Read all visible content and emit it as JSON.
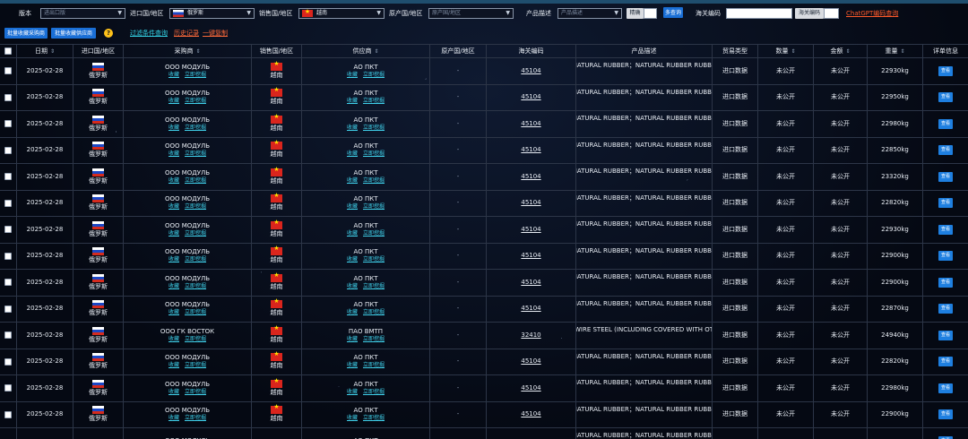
{
  "filters": {
    "version_label": "版本",
    "version_placeholder": "进出口版",
    "import_country_label": "进口国/地区",
    "import_country_value": "俄罗斯",
    "sales_country_label": "销售国/地区",
    "sales_country_value": "越南",
    "origin_country_label": "原产国/地区",
    "origin_country_placeholder": "原产国/地区",
    "product_desc_label": "产品描述",
    "product_desc_placeholder": "产品描述",
    "precise_button": "精确",
    "multi_query_button": "多查询",
    "hs_code_label": "海关编码",
    "hs_code_value": "",
    "hs_code_button": "海关编码",
    "chatgpt_link": "ChatGPT编码查询"
  },
  "toolbar": {
    "batch_fav_buyers": "批量收藏采购商",
    "batch_fav_suppliers": "批量收藏供应商",
    "hint_icon": "?",
    "filter_query": "过滤条件查询",
    "history": "历史记录",
    "copy_all": "一键复制"
  },
  "columns": {
    "date": "日期",
    "import_country": "进口国/地区",
    "buyer": "采购商",
    "sales_country": "销售国/地区",
    "supplier": "供应商",
    "origin_country": "原产国/地区",
    "hs_code": "海关编码",
    "product_desc": "产品描述",
    "trade_type": "贸易类型",
    "quantity": "数量",
    "amount": "金额",
    "weight": "重量",
    "detail": "详单信息"
  },
  "sort_glyph": "⇕",
  "row_actions": {
    "collect": "收藏",
    "mine": "立即挖掘"
  },
  "view_button": "查看",
  "rows": [
    {
      "date": "2025-02-28",
      "import_country": "俄罗斯",
      "buyer": "ООО МОДУЛЬ",
      "sales_country": "越南",
      "supplier": "АО ПКТ",
      "origin": "-",
      "hs_code": "45104",
      "desc": "NATURAL RUBBER；NATURAL RUBBER RUBBE",
      "trade_type": "进口数据",
      "qty": "未公开",
      "amount": "未公开",
      "weight": "22930kg"
    },
    {
      "date": "2025-02-28",
      "import_country": "俄罗斯",
      "buyer": "ООО МОДУЛЬ",
      "sales_country": "越南",
      "supplier": "АО ПКТ",
      "origin": "-",
      "hs_code": "45104",
      "desc": "NATURAL RUBBER；NATURAL RUBBER RUBBE",
      "trade_type": "进口数据",
      "qty": "未公开",
      "amount": "未公开",
      "weight": "22950kg"
    },
    {
      "date": "2025-02-28",
      "import_country": "俄罗斯",
      "buyer": "ООО МОДУЛЬ",
      "sales_country": "越南",
      "supplier": "АО ПКТ",
      "origin": "-",
      "hs_code": "45104",
      "desc": "NATURAL RUBBER；NATURAL RUBBER RUBBE",
      "trade_type": "进口数据",
      "qty": "未公开",
      "amount": "未公开",
      "weight": "22980kg"
    },
    {
      "date": "2025-02-28",
      "import_country": "俄罗斯",
      "buyer": "ООО МОДУЛЬ",
      "sales_country": "越南",
      "supplier": "АО ПКТ",
      "origin": "-",
      "hs_code": "45104",
      "desc": "NATURAL RUBBER；NATURAL RUBBER RUBBE",
      "trade_type": "进口数据",
      "qty": "未公开",
      "amount": "未公开",
      "weight": "22850kg"
    },
    {
      "date": "2025-02-28",
      "import_country": "俄罗斯",
      "buyer": "ООО МОДУЛЬ",
      "sales_country": "越南",
      "supplier": "АО ПКТ",
      "origin": "-",
      "hs_code": "45104",
      "desc": "NATURAL RUBBER；NATURAL RUBBER RUBBE",
      "trade_type": "进口数据",
      "qty": "未公开",
      "amount": "未公开",
      "weight": "23320kg"
    },
    {
      "date": "2025-02-28",
      "import_country": "俄罗斯",
      "buyer": "ООО МОДУЛЬ",
      "sales_country": "越南",
      "supplier": "АО ПКТ",
      "origin": "-",
      "hs_code": "45104",
      "desc": "NATURAL RUBBER；NATURAL RUBBER RUBBE",
      "trade_type": "进口数据",
      "qty": "未公开",
      "amount": "未公开",
      "weight": "22820kg"
    },
    {
      "date": "2025-02-28",
      "import_country": "俄罗斯",
      "buyer": "ООО МОДУЛЬ",
      "sales_country": "越南",
      "supplier": "АО ПКТ",
      "origin": "-",
      "hs_code": "45104",
      "desc": "NATURAL RUBBER；NATURAL RUBBER RUBBE",
      "trade_type": "进口数据",
      "qty": "未公开",
      "amount": "未公开",
      "weight": "22930kg"
    },
    {
      "date": "2025-02-28",
      "import_country": "俄罗斯",
      "buyer": "ООО МОДУЛЬ",
      "sales_country": "越南",
      "supplier": "АО ПКТ",
      "origin": "-",
      "hs_code": "45104",
      "desc": "NATURAL RUBBER；NATURAL RUBBER RUBBE",
      "trade_type": "进口数据",
      "qty": "未公开",
      "amount": "未公开",
      "weight": "22900kg"
    },
    {
      "date": "2025-02-28",
      "import_country": "俄罗斯",
      "buyer": "ООО МОДУЛЬ",
      "sales_country": "越南",
      "supplier": "АО ПКТ",
      "origin": "-",
      "hs_code": "45104",
      "desc": "NATURAL RUBBER；NATURAL RUBBER RUBBE",
      "trade_type": "进口数据",
      "qty": "未公开",
      "amount": "未公开",
      "weight": "22900kg"
    },
    {
      "date": "2025-02-28",
      "import_country": "俄罗斯",
      "buyer": "ООО МОДУЛЬ",
      "sales_country": "越南",
      "supplier": "АО ПКТ",
      "origin": "-",
      "hs_code": "45104",
      "desc": "NATURAL RUBBER；NATURAL RUBBER RUBBE",
      "trade_type": "进口数据",
      "qty": "未公开",
      "amount": "未公开",
      "weight": "22870kg"
    },
    {
      "date": "2025-02-28",
      "import_country": "俄罗斯",
      "buyer": "ООО ГК ВОСТОК",
      "sales_country": "越南",
      "supplier": "ПАО ВМТП",
      "origin": "-",
      "hs_code": "32410",
      "desc": "WIRE STEEL (INCLUDING COVERED WITH OT",
      "trade_type": "进口数据",
      "qty": "未公开",
      "amount": "未公开",
      "weight": "24940kg"
    },
    {
      "date": "2025-02-28",
      "import_country": "俄罗斯",
      "buyer": "ООО МОДУЛЬ",
      "sales_country": "越南",
      "supplier": "АО ПКТ",
      "origin": "-",
      "hs_code": "45104",
      "desc": "NATURAL RUBBER；NATURAL RUBBER RUBBE",
      "trade_type": "进口数据",
      "qty": "未公开",
      "amount": "未公开",
      "weight": "22820kg"
    },
    {
      "date": "2025-02-28",
      "import_country": "俄罗斯",
      "buyer": "ООО МОДУЛЬ",
      "sales_country": "越南",
      "supplier": "АО ПКТ",
      "origin": "-",
      "hs_code": "45104",
      "desc": "NATURAL RUBBER；NATURAL RUBBER RUBBE",
      "trade_type": "进口数据",
      "qty": "未公开",
      "amount": "未公开",
      "weight": "22980kg"
    },
    {
      "date": "2025-02-28",
      "import_country": "俄罗斯",
      "buyer": "ООО МОДУЛЬ",
      "sales_country": "越南",
      "supplier": "АО ПКТ",
      "origin": "-",
      "hs_code": "45104",
      "desc": "NATURAL RUBBER；NATURAL RUBBER RUBBE",
      "trade_type": "进口数据",
      "qty": "未公开",
      "amount": "未公开",
      "weight": "22900kg"
    },
    {
      "date": "",
      "import_country": "",
      "buyer": "ООО МОДУЛЬ",
      "sales_country": "",
      "supplier": "АО ПКТ",
      "origin": "",
      "hs_code": "",
      "desc": "NATURAL RUBBER；NATURAL RUBBER RUBBE",
      "trade_type": "",
      "qty": "",
      "amount": "",
      "weight": ""
    }
  ]
}
